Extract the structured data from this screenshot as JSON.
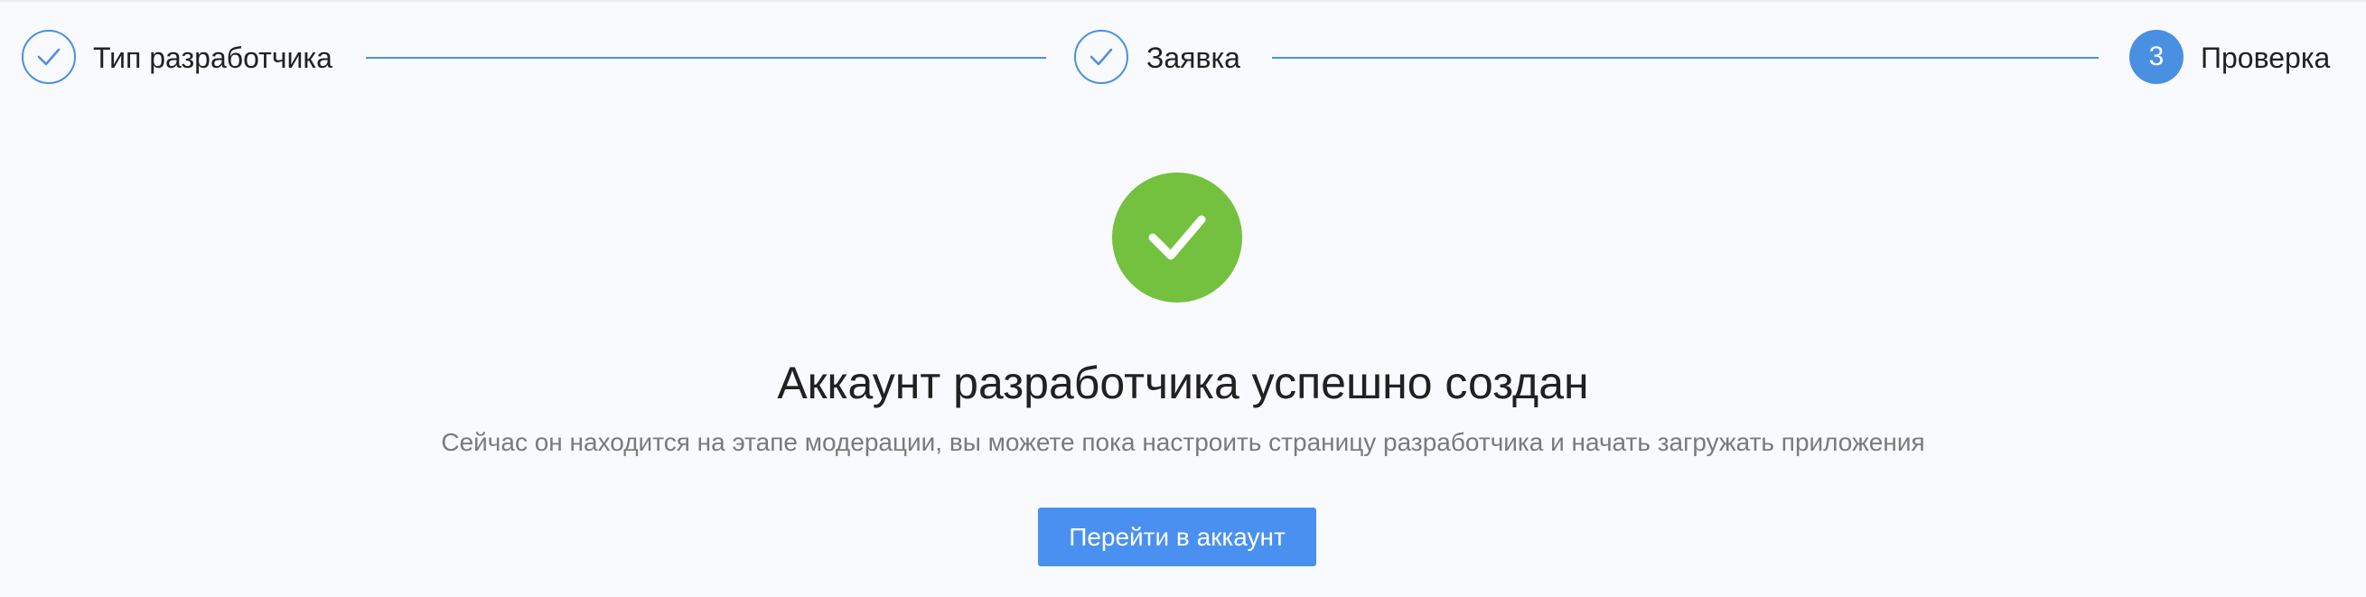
{
  "stepper": {
    "steps": [
      {
        "label": "Тип разработчика",
        "state": "done",
        "icon": "check-icon"
      },
      {
        "label": "Заявка",
        "state": "done",
        "icon": "check-icon"
      },
      {
        "label": "Проверка",
        "state": "active",
        "number": "3"
      }
    ]
  },
  "success": {
    "icon": "check-circle-icon",
    "title": "Аккаунт разработчика успешно создан",
    "subtitle": "Сейчас он находится на этапе модерации, вы можете пока настроить страницу разработчика и начать загружать приложения",
    "button_label": "Перейти в аккаунт"
  },
  "colors": {
    "accent": "#4a90e2",
    "button": "#4a90f0",
    "success": "#74c140",
    "background": "#f9fafd",
    "text": "#212121",
    "muted_text": "#7a7a7a"
  }
}
